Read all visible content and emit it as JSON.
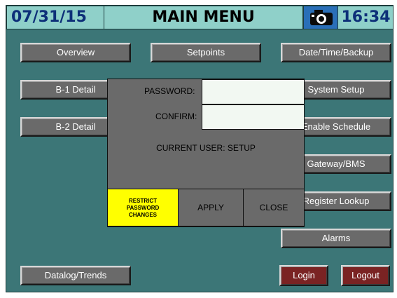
{
  "header": {
    "date": "07/31/15",
    "title": "MAIN MENU",
    "time": "16:34",
    "camera_icon": "camera-icon"
  },
  "menu": {
    "overview": "Overview",
    "setpoints": "Setpoints",
    "datetime_backup": "Date/Time/Backup",
    "b1_detail": "B-1 Detail",
    "system_setup": "System Setup",
    "b2_detail": "B-2 Detail",
    "enable_schedule": "Enable Schedule",
    "gateway_bms": "Gateway/BMS",
    "register_lookup": "Register Lookup",
    "alarms": "Alarms",
    "datalog_trends": "Datalog/Trends",
    "login": "Login",
    "logout": "Logout"
  },
  "dialog": {
    "password_label": "PASSWORD:",
    "password_value": "",
    "confirm_label": "CONFIRM:",
    "confirm_value": "",
    "current_user": "CURRENT USER: SETUP",
    "restrict_line1": "RESTRICT",
    "restrict_line2": "PASSWORD",
    "restrict_line3": "CHANGES",
    "apply": "APPLY",
    "close": "CLOSE"
  },
  "colors": {
    "background": "#3c7677",
    "header_bg": "#8fd0c9",
    "header_text": "#0d2f78",
    "button_gray": "#6a6a6a",
    "button_red": "#7a2323",
    "restrict_yellow": "#ffff00"
  }
}
